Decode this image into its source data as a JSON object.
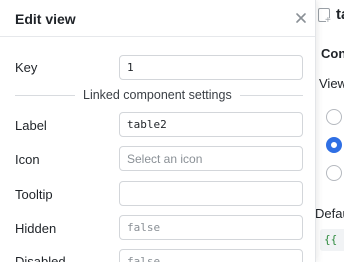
{
  "modal": {
    "title": "Edit view",
    "close_icon": "close-icon",
    "key": {
      "label": "Key",
      "value": "1"
    },
    "section_title": "Linked component settings",
    "label_field": {
      "label": "Label",
      "value": "table2"
    },
    "icon_field": {
      "label": "Icon",
      "placeholder": "Select an icon"
    },
    "tooltip_field": {
      "label": "Tooltip",
      "value": ""
    },
    "hidden_field": {
      "label": "Hidden",
      "value": "false"
    },
    "disabled_field": {
      "label": "Disabled",
      "value": "false"
    }
  },
  "background": {
    "sheet_icon": "sheet-add-icon",
    "title": "ta",
    "section": "Conte",
    "view_label": "View",
    "radios": [
      {
        "checked": false
      },
      {
        "checked": true
      },
      {
        "checked": false
      }
    ],
    "default_label": "Defau",
    "code_value": "{{ s"
  },
  "colors": {
    "accent": "#2f6fe4",
    "border": "#d3d6da",
    "text": "#1f2328",
    "code_green": "#2e8b3e"
  }
}
